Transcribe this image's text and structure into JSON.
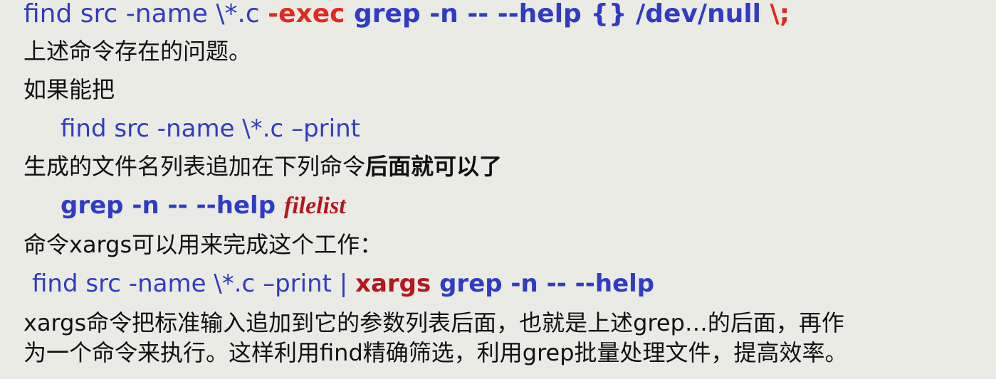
{
  "colors": {
    "background": "#ebebe6",
    "command_blue": "#2f3cc4",
    "highlight_red": "#e12a1f",
    "emphasis_dark_red": "#b3181c",
    "text_black": "#111111"
  },
  "lines": {
    "line1": {
      "part1": "find src -name \\*.c ",
      "part2": "-exec",
      "part3": " grep  -n -- --help {} /dev/null ",
      "part4": "\\;"
    },
    "line2": "上述命令存在的问题。",
    "line3": "如果能把",
    "line4": "find src -name \\*.c –print",
    "line5": {
      "normal": "生成的文件名列表追加在下列命令",
      "bold": "后面就可以了"
    },
    "line6": {
      "command": "grep  -n -- --help ",
      "placeholder": "filelist"
    },
    "line7": "命令xargs可以用来完成这个工作：",
    "line8": {
      "part1": "find src -name \\*.c –print | ",
      "part2": "xargs",
      "part3": " grep  -n -- --help"
    },
    "line9": "xargs命令把标准输入追加到它的参数列表后面，也就是上述grep…的后面，再作",
    "line10": "为一个命令来执行。这样利用find精确筛选，利用grep批量处理文件，提高效率。"
  }
}
